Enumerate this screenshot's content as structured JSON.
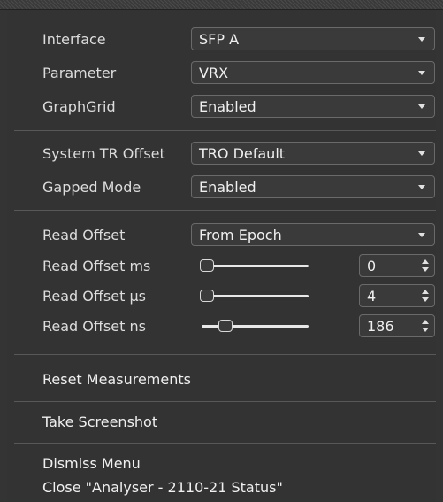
{
  "rows": {
    "interface": {
      "label": "Interface",
      "value": "SFP A"
    },
    "parameter": {
      "label": "Parameter",
      "value": "VRX"
    },
    "graphgrid": {
      "label": "GraphGrid",
      "value": "Enabled"
    },
    "system_tr_offset": {
      "label": "System TR Offset",
      "value": "TRO Default"
    },
    "gapped_mode": {
      "label": "Gapped Mode",
      "value": "Enabled"
    },
    "read_offset": {
      "label": "Read Offset",
      "value": "From Epoch"
    },
    "read_offset_ms": {
      "label": "Read Offset ms",
      "value": "0",
      "level": 0
    },
    "read_offset_us": {
      "label": "Read Offset µs",
      "value": "4",
      "level": 0
    },
    "read_offset_ns": {
      "label": "Read Offset ns",
      "value": "186",
      "level": 0.19
    }
  },
  "menu": {
    "reset": "Reset Measurements",
    "screenshot": "Take Screenshot",
    "dismiss": "Dismiss Menu",
    "close": "Close \"Analyser - 2110-21 Status\""
  }
}
